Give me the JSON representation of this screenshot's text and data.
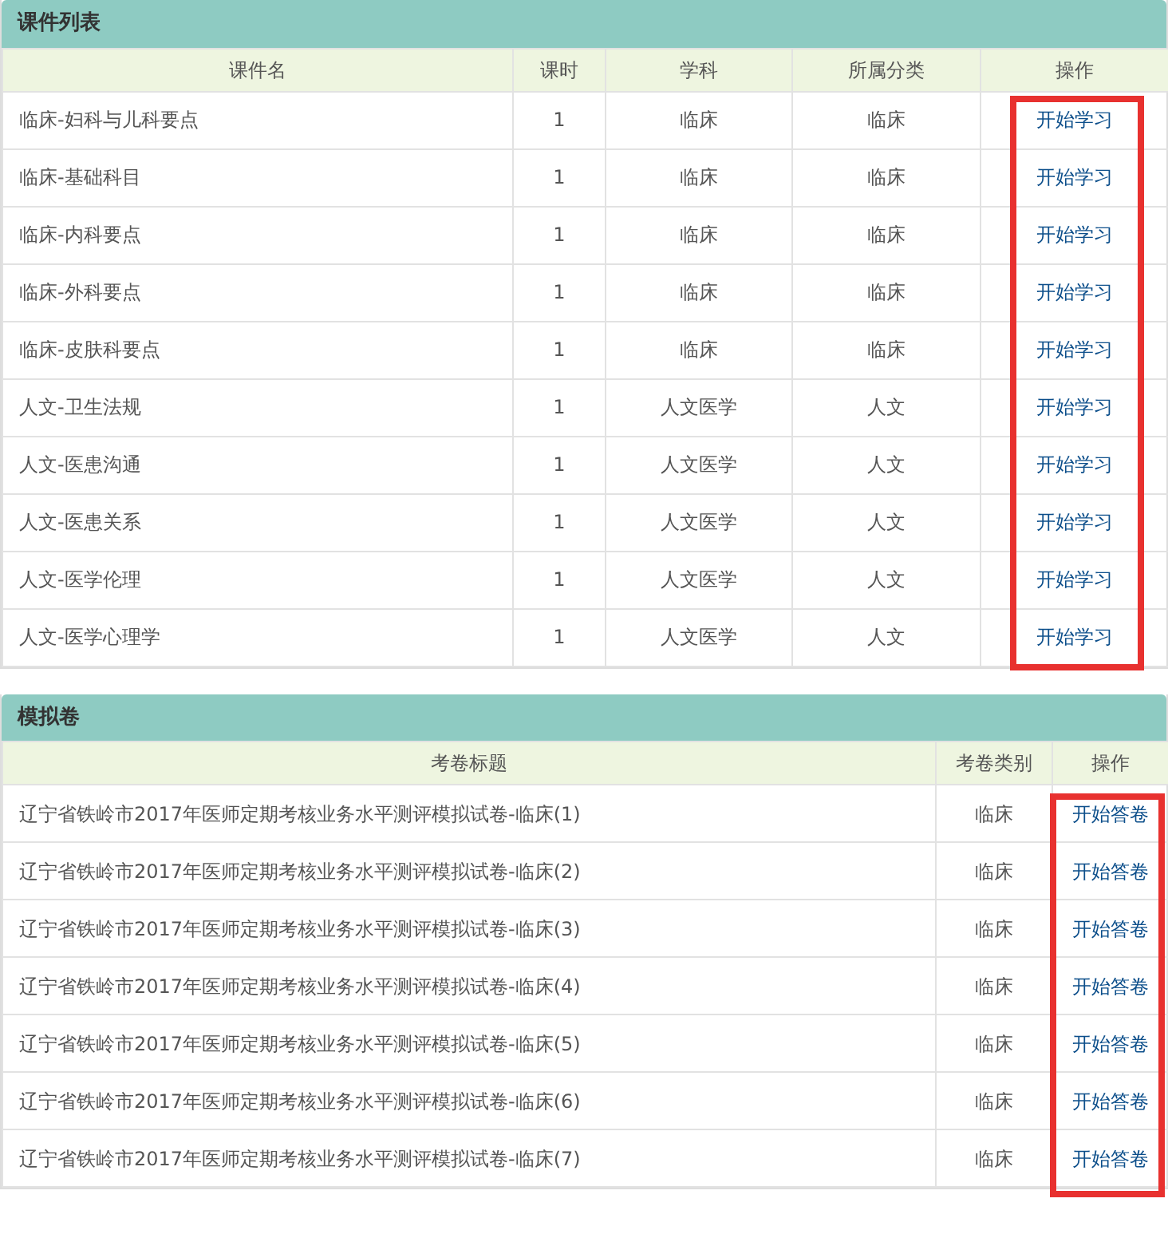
{
  "courses": {
    "title": "课件列表",
    "highlighted": true,
    "columns": [
      "课件名",
      "课时",
      "学科",
      "所属分类",
      "操作"
    ],
    "rows": [
      {
        "name": "临床-妇科与儿科要点",
        "hours": "1",
        "subject": "临床",
        "category": "临床",
        "action": "开始学习"
      },
      {
        "name": "临床-基础科目",
        "hours": "1",
        "subject": "临床",
        "category": "临床",
        "action": "开始学习"
      },
      {
        "name": "临床-内科要点",
        "hours": "1",
        "subject": "临床",
        "category": "临床",
        "action": "开始学习"
      },
      {
        "name": "临床-外科要点",
        "hours": "1",
        "subject": "临床",
        "category": "临床",
        "action": "开始学习"
      },
      {
        "name": "临床-皮肤科要点",
        "hours": "1",
        "subject": "临床",
        "category": "临床",
        "action": "开始学习"
      },
      {
        "name": "人文-卫生法规",
        "hours": "1",
        "subject": "人文医学",
        "category": "人文",
        "action": "开始学习"
      },
      {
        "name": "人文-医患沟通",
        "hours": "1",
        "subject": "人文医学",
        "category": "人文",
        "action": "开始学习"
      },
      {
        "name": "人文-医患关系",
        "hours": "1",
        "subject": "人文医学",
        "category": "人文",
        "action": "开始学习"
      },
      {
        "name": "人文-医学伦理",
        "hours": "1",
        "subject": "人文医学",
        "category": "人文",
        "action": "开始学习"
      },
      {
        "name": "人文-医学心理学",
        "hours": "1",
        "subject": "人文医学",
        "category": "人文",
        "action": "开始学习"
      }
    ]
  },
  "mock_exams": {
    "title": "模拟卷",
    "highlighted": true,
    "columns": [
      "考卷标题",
      "考卷类别",
      "操作"
    ],
    "rows": [
      {
        "title": "辽宁省铁岭市2017年医师定期考核业务水平测评模拟试卷-临床(1)",
        "type": "临床",
        "action": "开始答卷"
      },
      {
        "title": "辽宁省铁岭市2017年医师定期考核业务水平测评模拟试卷-临床(2)",
        "type": "临床",
        "action": "开始答卷"
      },
      {
        "title": "辽宁省铁岭市2017年医师定期考核业务水平测评模拟试卷-临床(3)",
        "type": "临床",
        "action": "开始答卷"
      },
      {
        "title": "辽宁省铁岭市2017年医师定期考核业务水平测评模拟试卷-临床(4)",
        "type": "临床",
        "action": "开始答卷"
      },
      {
        "title": "辽宁省铁岭市2017年医师定期考核业务水平测评模拟试卷-临床(5)",
        "type": "临床",
        "action": "开始答卷"
      },
      {
        "title": "辽宁省铁岭市2017年医师定期考核业务水平测评模拟试卷-临床(6)",
        "type": "临床",
        "action": "开始答卷"
      },
      {
        "title": "辽宁省铁岭市2017年医师定期考核业务水平测评模拟试卷-临床(7)",
        "type": "临床",
        "action": "开始答卷"
      }
    ]
  }
}
